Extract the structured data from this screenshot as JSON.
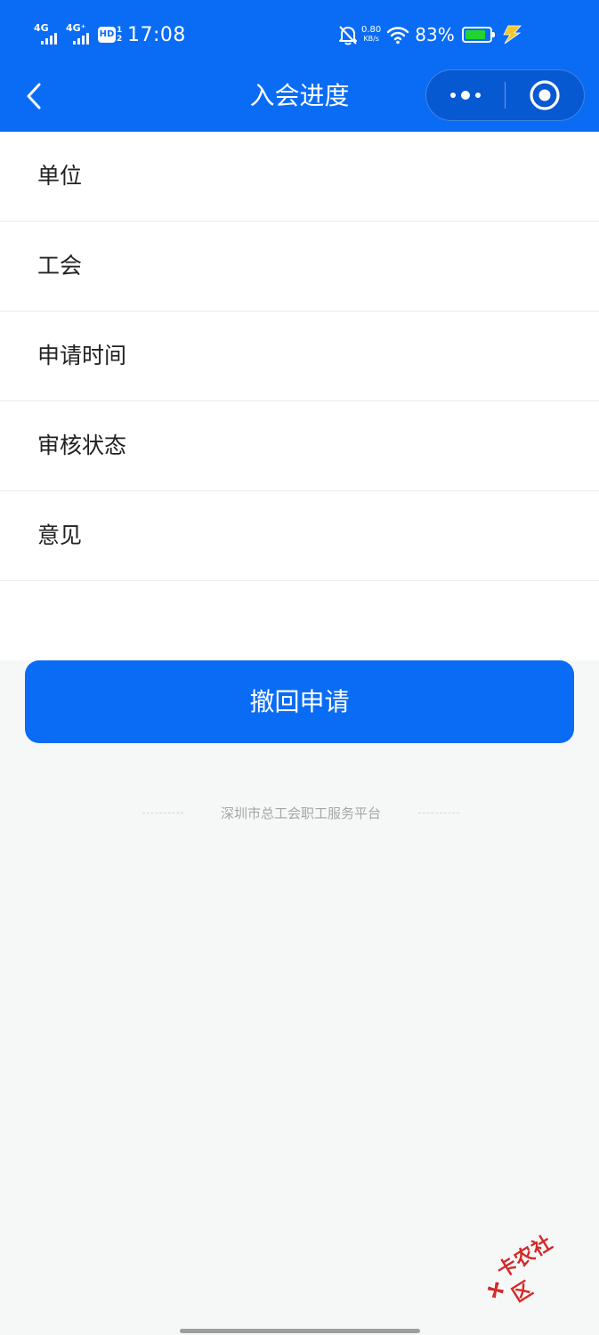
{
  "status_bar": {
    "net1": "4G",
    "net2": "4G⁺",
    "hd": "HD",
    "hd_sub": "1 2",
    "time": "17:08",
    "speed_value": "0.80",
    "speed_unit": "KB/s",
    "battery_pct": "83%",
    "battery_level": 0.83,
    "battery_color": "#22d430"
  },
  "nav": {
    "title": "入会进度",
    "back_icon": "chevron-left-icon",
    "menu_icon": "more-dots-icon",
    "close_icon": "target-circle-icon"
  },
  "fields": [
    {
      "label": "单位",
      "value": ""
    },
    {
      "label": "工会",
      "value": ""
    },
    {
      "label": "申请时间",
      "value": ""
    },
    {
      "label": "审核状态",
      "value": ""
    },
    {
      "label": "意见",
      "value": ""
    }
  ],
  "withdraw_button": {
    "label": "撤回申请"
  },
  "footer": {
    "text": "深圳市总工会职工服务平台"
  },
  "watermark": {
    "text": "卡农社区"
  },
  "colors": {
    "brand": "#0a6cf5",
    "background": "#f6f7f7"
  }
}
